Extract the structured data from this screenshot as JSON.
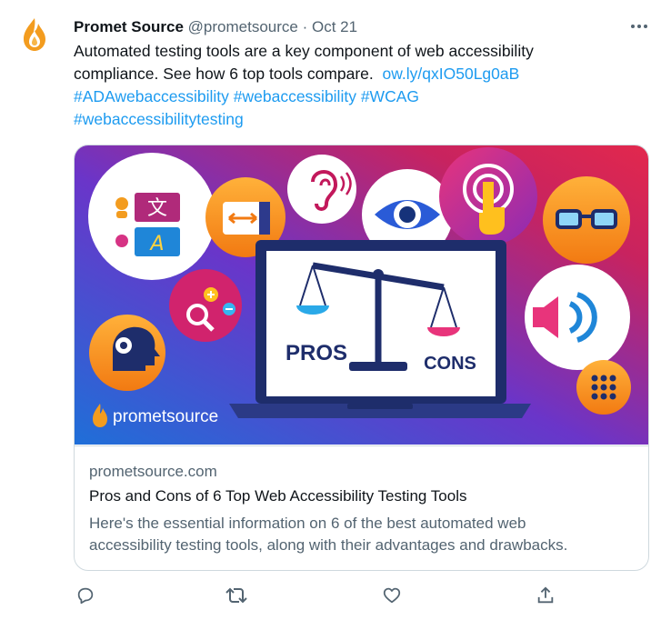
{
  "tweet": {
    "author_name": "Promet Source",
    "author_handle": "@prometsource",
    "separator": "·",
    "date": "Oct 21",
    "text_line1": "Automated testing tools are a key component of web accessibility",
    "text_line2": "compliance. See how 6 top tools compare.",
    "link": "ow.ly/qxIO50Lg0aB",
    "hashtags": [
      "#ADAwebaccessibility",
      "#webaccessibility",
      "#WCAG",
      "#webaccessibilitytesting"
    ],
    "avatar_icon": "flame-logo-icon",
    "more_icon": "more-options-icon"
  },
  "card": {
    "image": {
      "pros_label": "PROS",
      "cons_label": "CONS",
      "lang_glyph1": "文",
      "lang_glyph2": "A",
      "brand": "prometsource"
    },
    "domain": "prometsource.com",
    "title": "Pros and Cons of 6 Top Web Accessibility Testing Tools",
    "description_line1": "Here's the essential information on 6 of the best automated web",
    "description_line2": "accessibility testing tools, along with their advantages and drawbacks."
  },
  "actions": [
    {
      "name": "reply",
      "icon": "reply-icon"
    },
    {
      "name": "retweet",
      "icon": "retweet-icon"
    },
    {
      "name": "like",
      "icon": "heart-icon"
    },
    {
      "name": "share",
      "icon": "share-icon"
    }
  ],
  "colors": {
    "link": "#1d9bf0",
    "muted": "#536471",
    "text": "#0f1419",
    "brand_orange": "#f39c1f",
    "card_border": "#cfd9de"
  }
}
